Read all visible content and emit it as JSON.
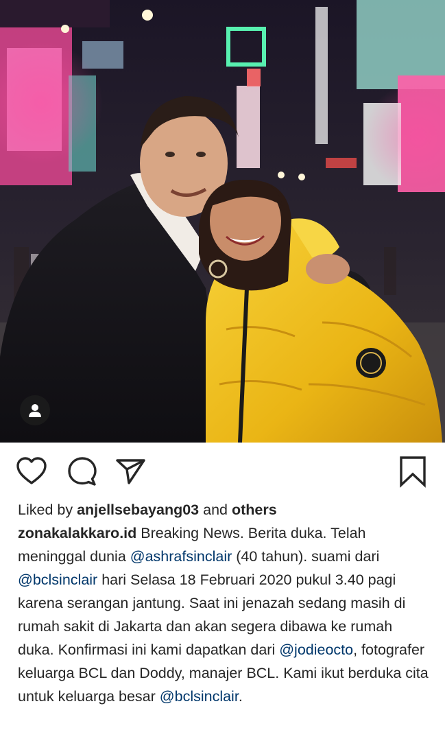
{
  "post": {
    "likes_prefix": "Liked by ",
    "liked_by_user": "anjellsebayang03",
    "likes_joiner": " and ",
    "likes_others": "others",
    "author": "zonakalakkaro.id",
    "caption": {
      "part1": " Breaking News. Berita duka. Telah meninggal dunia ",
      "mention1": "@ashrafsinclair",
      "part2": " (40 tahun). suami dari ",
      "mention2": "@bclsinclair",
      "part3": " hari Selasa 18 Februari 2020 pukul 3.40 pagi karena serangan jantung. Saat ini jenazah sedang masih di rumah sakit di Jakarta dan akan segera dibawa ke rumah duka. Konfirmasi ini kami dapatkan dari ",
      "mention3": "@jodieocto",
      "part4": ", fotografer keluarga BCL dan Doddy, manajer BCL. Kami ikut berduka cita untuk keluarga besar ",
      "mention4": "@bclsinclair",
      "part5": "."
    }
  },
  "icons": {
    "like": "heart-icon",
    "comment": "comment-icon",
    "share": "send-icon",
    "save": "bookmark-icon",
    "tags": "person-icon"
  },
  "colors": {
    "text": "#262626",
    "mention": "#00376b",
    "jacket": "#f2c31a",
    "background": "#ffffff"
  }
}
